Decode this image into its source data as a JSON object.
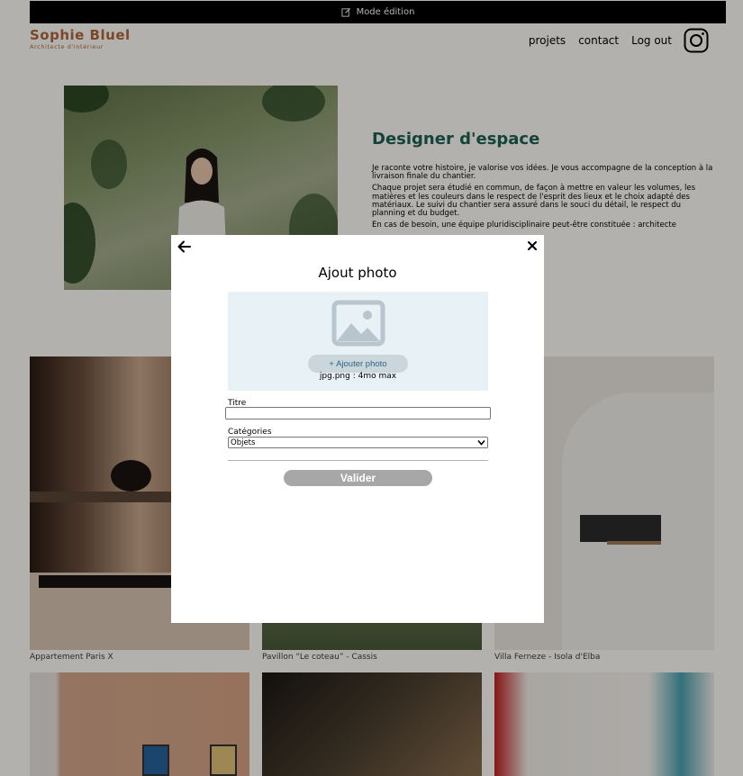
{
  "edit_bar": {
    "label": "Mode édition",
    "icon": "edit-icon"
  },
  "header": {
    "logo_name": "Sophie Bluel",
    "logo_sub": "Architecte d'intérieur",
    "nav": [
      "projets",
      "contact",
      "Log out"
    ],
    "instagram_icon": "instagram-icon"
  },
  "intro": {
    "title": "Designer d'espace",
    "paragraphs": [
      "Je raconte votre histoire, je valorise vos idées. Je vous accompagne de la conception à la livraison finale du chantier.",
      "Chaque projet sera étudié en commun, de façon à mettre en valeur les volumes, les matières et les couleurs dans le respect de l'esprit des lieux et le choix adapté des matériaux. Le suivi du chantier sera assuré dans le souci du détail, le respect du planning et du budget.",
      "En cas de besoin, une équipe pluridisciplinaire peut-être constituée : architecte"
    ]
  },
  "gallery": {
    "captions": [
      "Appartement Paris X",
      "Pavillon “Le coteau” - Cassis",
      "Villa Ferneze - Isola d'Elba"
    ]
  },
  "modal": {
    "title": "Ajout photo",
    "add_photo_label": "+ Ajouter photo",
    "upload_hint": "jpg.png : 4mo max",
    "title_label": "Titre",
    "title_value": "",
    "category_label": "Catégories",
    "category_value": "Objets",
    "submit_label": "Valider",
    "colors": {
      "upload_bg": "#e8f1f6",
      "submit_disabled": "#a7a7a7",
      "brand": "#1d6154"
    }
  }
}
